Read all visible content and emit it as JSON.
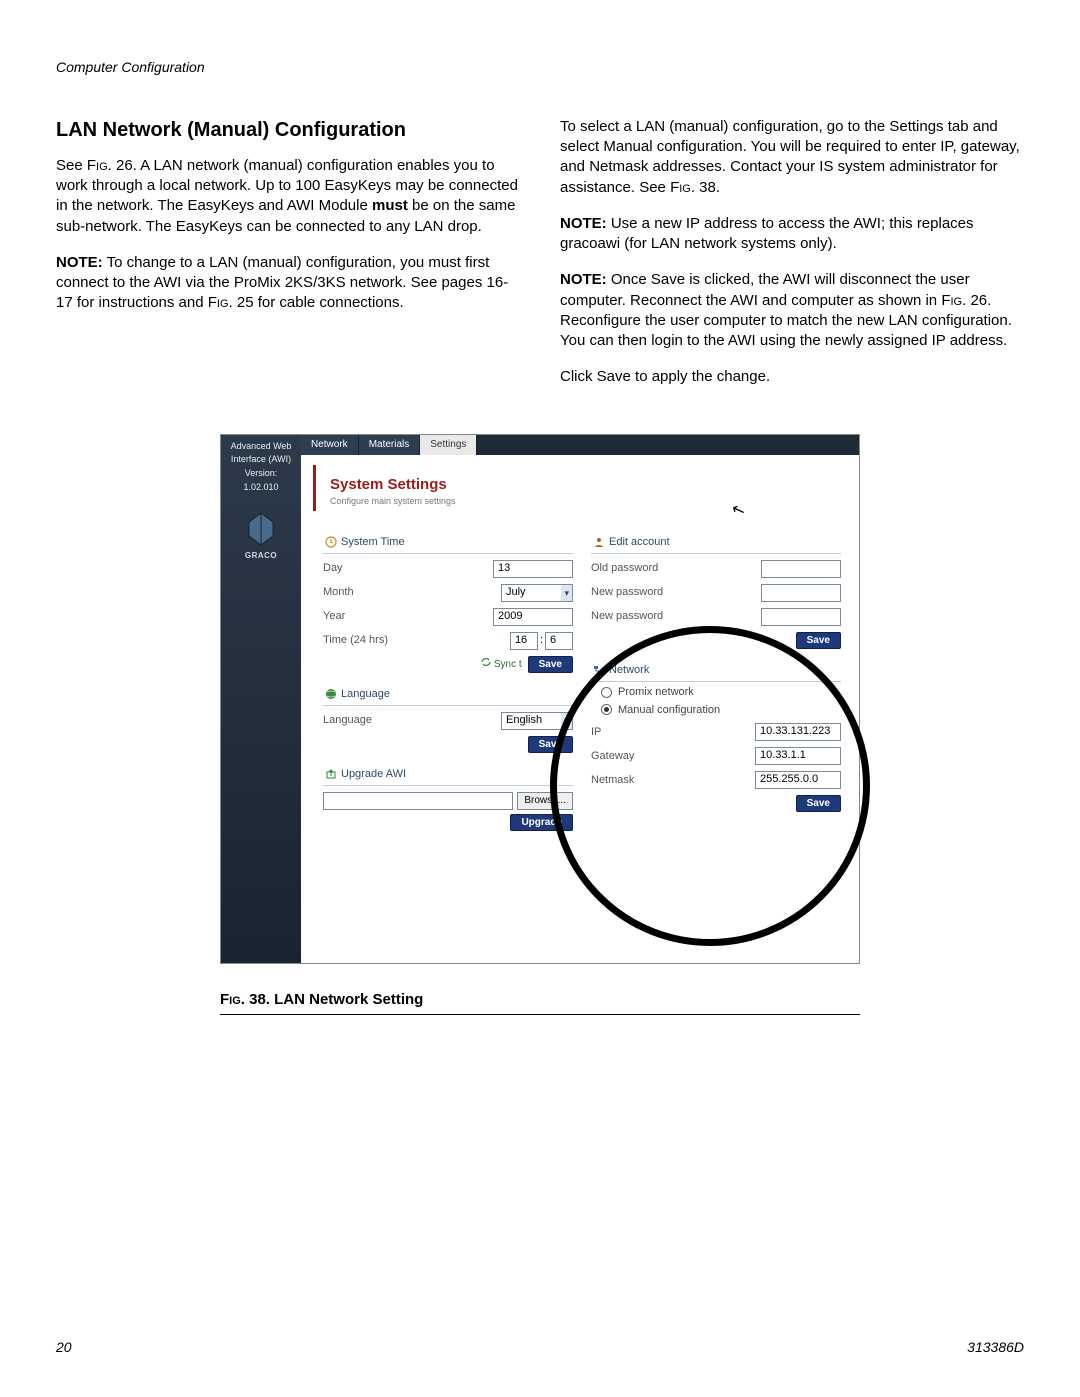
{
  "header": {
    "section": "Computer Configuration"
  },
  "left_col": {
    "title": "LAN Network (Manual) Configuration",
    "p1a": "See ",
    "p1_fig": "Fig",
    "p1b": ". 26. A LAN network (manual) configuration enables you to work through a local network. Up to 100 EasyKeys may be connected in the network. The EasyKeys and AWI Module ",
    "p1_bold": "must",
    "p1c": " be on the same sub-network. The EasyKeys can be connected to any LAN drop.",
    "p2_bold": "NOTE:",
    "p2a": " To change to a LAN (manual) configuration, you must first connect to the AWI via the ProMix 2KS/3KS network. See pages 16-17 for instructions and ",
    "p2_fig": "Fig",
    "p2b": ". 25 for cable connections."
  },
  "right_col": {
    "p1a": "To select a LAN (manual) configuration, go to the Settings tab and select Manual configuration. You will be required to enter IP, gateway, and Netmask addresses. Contact your IS system administrator for assistance. See ",
    "p1_fig": "Fig",
    "p1b": ". 38.",
    "p2_bold": "NOTE:",
    "p2": " Use a new IP address to access the AWI; this replaces gracoawi (for LAN network systems only).",
    "p3_bold": "NOTE:",
    "p3a": " Once Save is clicked, the AWI will disconnect the user computer. Reconnect the AWI and computer as shown in ",
    "p3_fig": "Fig",
    "p3b": ". 26. Reconfigure the user computer to match the new LAN configuration. You can then login to the AWI using the newly assigned IP address.",
    "p4": "Click Save to apply the change."
  },
  "app": {
    "sidebar": {
      "line1": "Advanced Web",
      "line2": "Interface (AWI)",
      "line3": "Version:",
      "version": "1.02.010",
      "brand": "GRACO"
    },
    "tabs": {
      "network": "Network",
      "materials": "Materials",
      "settings": "Settings"
    },
    "heading": {
      "title": "System Settings",
      "sub": "Configure main system settings"
    },
    "system_time": {
      "header": "System Time",
      "day_lbl": "Day",
      "day_val": "13",
      "month_lbl": "Month",
      "month_val": "July",
      "year_lbl": "Year",
      "year_val": "2009",
      "time_lbl": "Time (24 hrs)",
      "hr": "16",
      "min": "6",
      "sync": "Sync t",
      "save": "Save"
    },
    "language": {
      "header": "Language",
      "lbl": "Language",
      "val": "English",
      "save": "Save"
    },
    "upgrade": {
      "header": "Upgrade AWI",
      "browse": "Browse...",
      "btn": "Upgrade"
    },
    "account": {
      "header": "Edit account",
      "old": "Old password",
      "new1": "New password",
      "new2": "New password",
      "save": "Save"
    },
    "network": {
      "header": "Network",
      "opt1": "Promix network",
      "opt2": "Manual configuration",
      "ip_lbl": "IP",
      "ip_val": "10.33.131.223",
      "gw_lbl": "Gateway",
      "gw_val": "10.33.1.1",
      "nm_lbl": "Netmask",
      "nm_val": "255.255.0.0",
      "save": "Save"
    }
  },
  "figure_caption": "FIG. 38. LAN Network Setting",
  "footer": {
    "page": "20",
    "doc": "313386D"
  }
}
